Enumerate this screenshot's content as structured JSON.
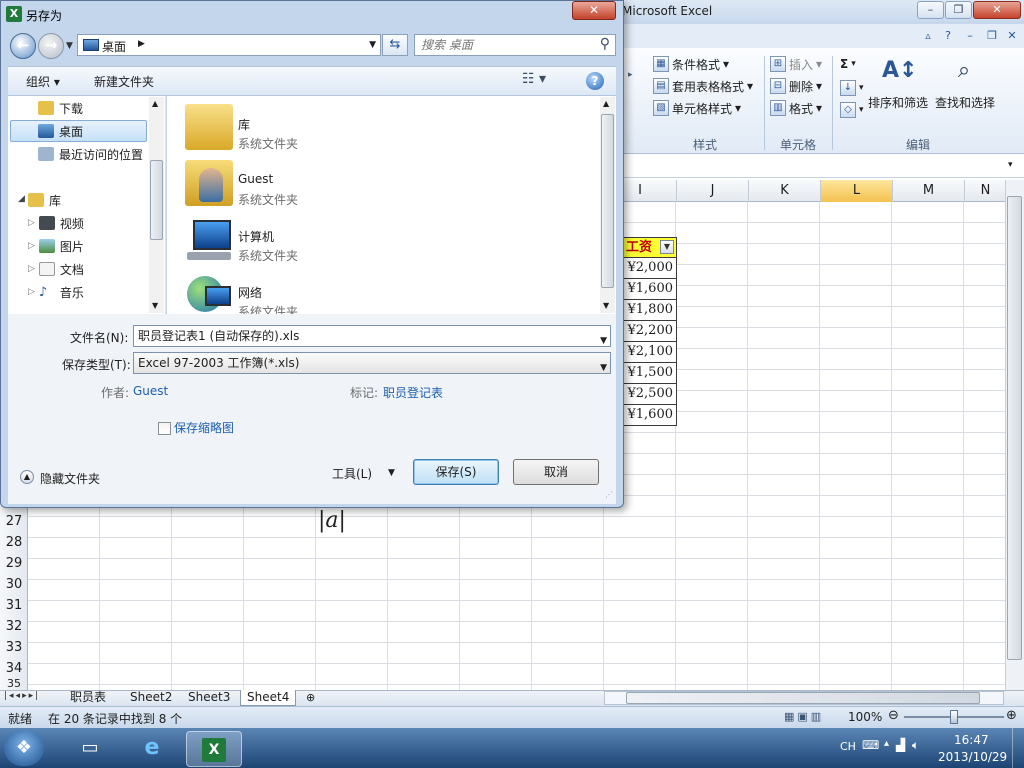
{
  "excel": {
    "title": "Microsoft Excel",
    "window_buttons": {
      "min": "–",
      "max": "❐",
      "close": "✕"
    },
    "ribbon": {
      "styles": {
        "conditional": "条件格式",
        "table": "套用表格格式",
        "cell": "单元格样式",
        "group": "样式"
      },
      "cells": {
        "insert": "插入",
        "delete": "删除",
        "format": "格式",
        "group": "单元格"
      },
      "editing": {
        "sum": "Σ",
        "sort": "排序和筛选",
        "find": "查找和选择",
        "group": "编辑"
      }
    },
    "columns": [
      "I",
      "J",
      "K",
      "L",
      "M",
      "N"
    ],
    "selected_column": "L",
    "header_cell": "工资",
    "values": [
      "¥2,000",
      "¥1,600",
      "¥1,800",
      "¥2,200",
      "¥2,100",
      "¥1,500",
      "¥2,500",
      "¥1,600"
    ],
    "rows": [
      "27",
      "28",
      "29",
      "30",
      "31",
      "32",
      "33",
      "34",
      "35"
    ],
    "cursor_text": "|a|",
    "sheets": [
      "职员表",
      "Sheet2",
      "Sheet3",
      "Sheet4"
    ],
    "active_sheet": "Sheet4",
    "status": {
      "ready": "就绪",
      "filter": "在 20 条记录中找到 8 个",
      "zoom": "100%"
    }
  },
  "taskbar": {
    "lang": "CH",
    "time": "16:47",
    "date": "2013/10/29"
  },
  "dialog": {
    "title": "另存为",
    "close": "✕",
    "address": "桌面",
    "search_placeholder": "搜索 桌面",
    "toolbar": {
      "organize": "组织 ▾",
      "new_folder": "新建文件夹",
      "help": "?"
    },
    "nav_items": [
      "下载",
      "桌面",
      "最近访问的位置",
      "库",
      "视频",
      "图片",
      "文档",
      "音乐"
    ],
    "selected_nav": "桌面",
    "files": [
      {
        "name": "库",
        "type": "系统文件夹",
        "icon": "library-folder-icon"
      },
      {
        "name": "Guest",
        "type": "系统文件夹",
        "icon": "user-folder-icon"
      },
      {
        "name": "计算机",
        "type": "系统文件夹",
        "icon": "computer-icon"
      },
      {
        "name": "网络",
        "type": "系统文件夹",
        "icon": "network-icon"
      }
    ],
    "filename_label": "文件名(N):",
    "filename_value": "职员登记表1 (自动保存的).xls",
    "filetype_label": "保存类型(T):",
    "filetype_value": "Excel 97-2003 工作簿(*.xls)",
    "author_label": "作者:",
    "author_value": "Guest",
    "tags_label": "标记:",
    "tags_value": "职员登记表",
    "thumbnail_label": "保存缩略图",
    "hide_folders": "隐藏文件夹",
    "tools": "工具(L)",
    "save": "保存(S)",
    "cancel": "取消"
  }
}
